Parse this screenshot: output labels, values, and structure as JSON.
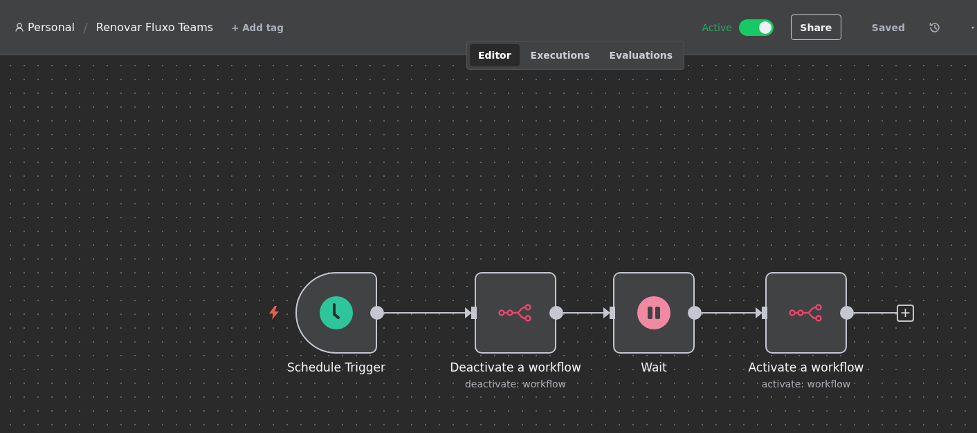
{
  "header": {
    "project": "Personal",
    "separator": "/",
    "title": "Renovar Fluxo Teams",
    "add_tag": "+ Add tag",
    "active_label": "Active",
    "active_toggle": {
      "on": true
    },
    "share": "Share",
    "saved": "Saved"
  },
  "tabs": [
    {
      "label": "Editor",
      "selected": true
    },
    {
      "label": "Executions",
      "selected": false
    },
    {
      "label": "Evaluations",
      "selected": false
    }
  ],
  "nodes": [
    {
      "kind": "trigger",
      "name": "Schedule Trigger"
    },
    {
      "kind": "action",
      "name": "Deactivate a workflow",
      "subtitle": "deactivate: workflow"
    },
    {
      "kind": "wait",
      "name": "Wait"
    },
    {
      "kind": "action",
      "name": "Activate a workflow",
      "subtitle": "activate: workflow"
    }
  ]
}
